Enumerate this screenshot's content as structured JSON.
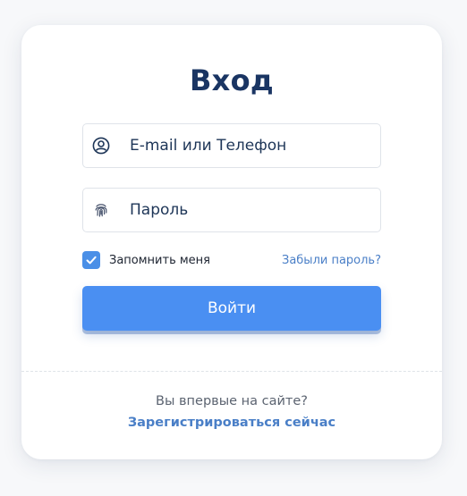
{
  "login": {
    "title": "Вход",
    "email_placeholder": "E-mail или Телефон",
    "password_placeholder": "Пароль",
    "remember_label": "Запомнить меня",
    "remember_checked": true,
    "forgot_label": "Забыли пароль?",
    "submit_label": "Войти"
  },
  "register": {
    "prompt": "Вы впервые на сайте?",
    "link_label": "Зарегистрироваться сейчас"
  },
  "icons": {
    "email_field": "user-circle-icon",
    "password_field": "fingerprint-icon",
    "checkbox": "checkmark-icon"
  },
  "colors": {
    "title": "#1a3563",
    "accent": "#4a8ff2",
    "link": "#4a7fc7",
    "checkbox": "#4a8fe7"
  }
}
